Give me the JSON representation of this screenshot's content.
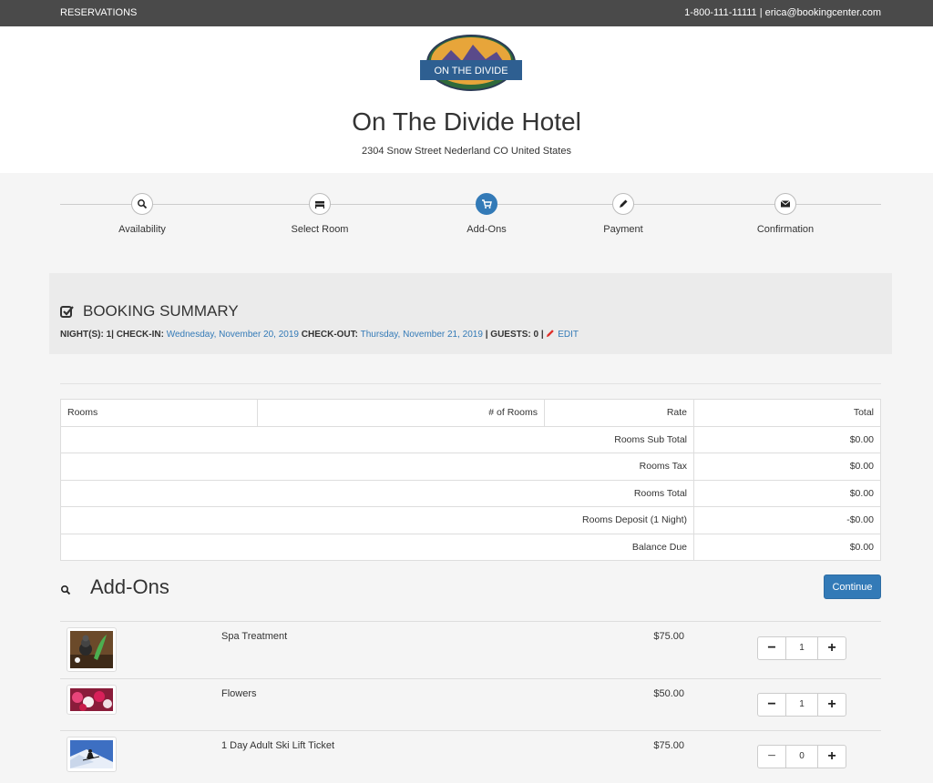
{
  "topbar": {
    "reservations": "RESERVATIONS",
    "contact": "1-800-111-11111 |  erica@bookingcenter.com"
  },
  "header": {
    "logo_text": "ON THE DIVIDE",
    "hotel_name": "On The Divide Hotel",
    "address": "2304 Snow Street Nederland CO United States"
  },
  "steps": [
    {
      "label": "Availability",
      "icon": "search-icon",
      "active": false
    },
    {
      "label": "Select Room",
      "icon": "bed-icon",
      "active": false
    },
    {
      "label": "Add-Ons",
      "icon": "cart-icon",
      "active": true
    },
    {
      "label": "Payment",
      "icon": "pencil-icon",
      "active": false
    },
    {
      "label": "Confirmation",
      "icon": "envelope-icon",
      "active": false
    }
  ],
  "summary": {
    "title": "BOOKING SUMMARY",
    "nights_label": "NIGHT(S):",
    "nights_value": "1",
    "checkin_label": "| CHECK-IN:",
    "checkin_value": "Wednesday, November 20, 2019",
    "checkout_label": "CHECK-OUT:",
    "checkout_value": "Thursday, November 21, 2019",
    "guests_label": "| GUESTS: 0 |",
    "edit_label": "EDIT"
  },
  "rooms_table": {
    "headers": [
      "Rooms",
      "# of Rooms",
      "Rate",
      "Total"
    ],
    "rows": [
      {
        "label": "Rooms Sub Total",
        "value": "$0.00"
      },
      {
        "label": "Rooms Tax",
        "value": "$0.00"
      },
      {
        "label": "Rooms Total",
        "value": "$0.00"
      },
      {
        "label": "Rooms Deposit (1 Night)",
        "value": "-$0.00"
      },
      {
        "label": "Balance Due",
        "value": "$0.00"
      }
    ]
  },
  "addons": {
    "heading": "Add-Ons",
    "continue_label": "Continue",
    "items": [
      {
        "name": "Spa Treatment",
        "price": "$75.00",
        "qty": "1"
      },
      {
        "name": "Flowers",
        "price": "$50.00",
        "qty": "1"
      },
      {
        "name": "1 Day Adult Ski Lift Ticket",
        "price": "$75.00",
        "qty": "0"
      }
    ],
    "minus": "−",
    "plus": "+"
  },
  "colors": {
    "accent": "#337ab7",
    "topbar": "#4a4a4a"
  }
}
